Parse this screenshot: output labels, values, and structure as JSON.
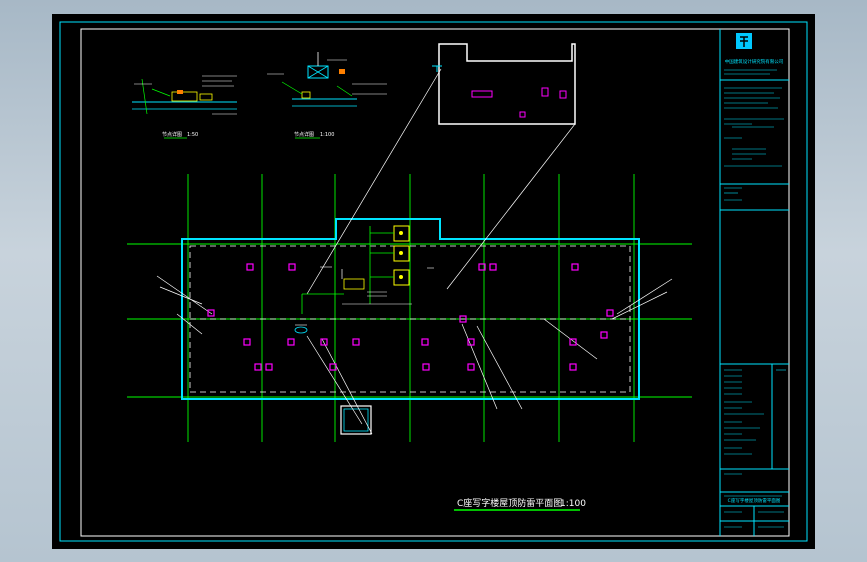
{
  "drawing": {
    "main_title": "C座写字楼屋顶防雷平面图",
    "main_scale": "1:100",
    "detail_1_label": "节点详图",
    "detail_1_scale": "1:50",
    "detail_2_label": "节点详图",
    "detail_2_scale": "1:100"
  },
  "title_block": {
    "company": "中国建筑设计研究院有限公司",
    "sheet_title": "C座写字楼屋顶防雷平面图"
  },
  "colors": {
    "sheet_border": "#00e5ff",
    "axis_lines": "#00ff00",
    "dashed_lines": "#ffffff",
    "equipment": "#ff00ff",
    "annotation": "#ffff00",
    "background": "#000000"
  }
}
